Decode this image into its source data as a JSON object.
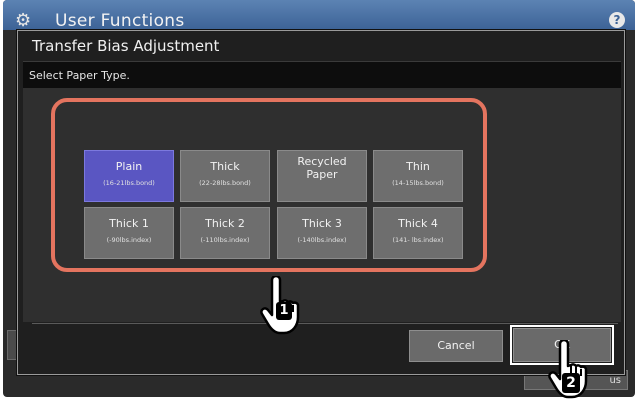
{
  "header": {
    "title": "User Functions",
    "help_label": "?"
  },
  "dialog": {
    "title": "Transfer Bias Adjustment",
    "message": "Select Paper Type."
  },
  "paper_types": [
    {
      "label": "Plain",
      "sub": "(16-21lbs.bond)",
      "selected": true
    },
    {
      "label": "Thick",
      "sub": "(22-28lbs.bond)",
      "selected": false
    },
    {
      "label": "Recycled\nPaper",
      "sub": "",
      "selected": false
    },
    {
      "label": "Thin",
      "sub": "(14-15lbs.bond)",
      "selected": false
    },
    {
      "label": "Thick 1",
      "sub": "(-90lbs.index)",
      "selected": false
    },
    {
      "label": "Thick 2",
      "sub": "(-110lbs.index)",
      "selected": false
    },
    {
      "label": "Thick 3",
      "sub": "(-140lbs.index)",
      "selected": false
    },
    {
      "label": "Thick 4",
      "sub": "(141- lbs.index)",
      "selected": false
    }
  ],
  "buttons": {
    "cancel": "Cancel",
    "ok": "OK"
  },
  "background": {
    "partial_button": "us"
  },
  "annotations": {
    "step1": "1",
    "step2": "2"
  },
  "colors": {
    "header": "#4a70a3",
    "selected": "#5a56c2",
    "button": "#6e6e6e",
    "highlight": "#e4745f"
  }
}
